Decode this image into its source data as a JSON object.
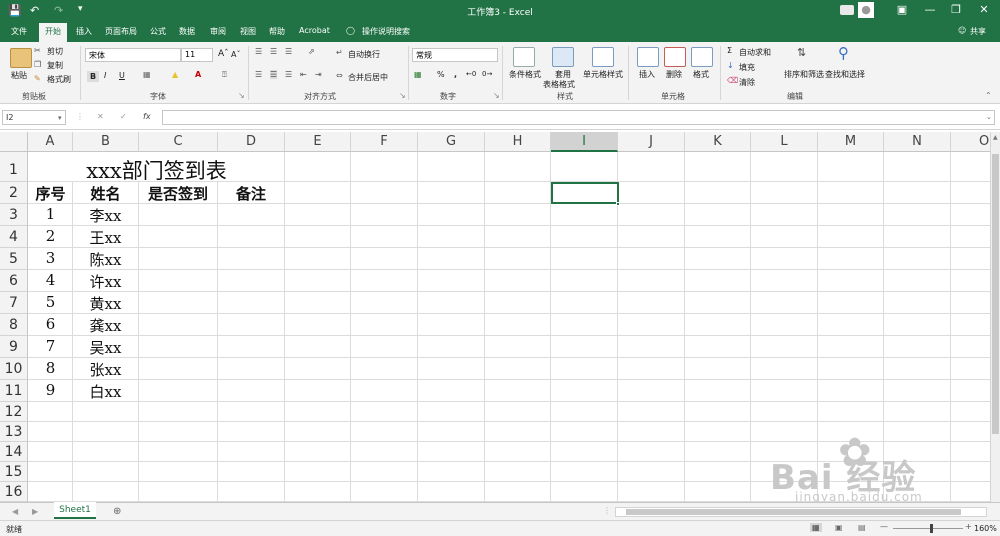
{
  "titlebar": {
    "title": "工作簿3 - Excel"
  },
  "tabs": [
    {
      "label": "文件"
    },
    {
      "label": "开始"
    },
    {
      "label": "插入"
    },
    {
      "label": "页面布局"
    },
    {
      "label": "公式"
    },
    {
      "label": "数据"
    },
    {
      "label": "审阅"
    },
    {
      "label": "视图"
    },
    {
      "label": "帮助"
    },
    {
      "label": "Acrobat"
    },
    {
      "label": "操作说明搜索"
    }
  ],
  "share_label": "共享",
  "ribbon": {
    "paste": "粘贴",
    "cut": "剪切",
    "copy": "复制",
    "format_painter": "格式刷",
    "font_name": "宋体",
    "font_size": "11",
    "wrap_text": "自动换行",
    "merge_center": "合并后居中",
    "number_format": "常规",
    "cond_format": "条件格式",
    "table_format_1": "套用",
    "table_format_2": "表格格式",
    "cell_style": "单元格样式",
    "insert": "插入",
    "delete": "删除",
    "format": "格式",
    "autosum": "自动求和",
    "fill": "填充",
    "clear": "清除",
    "sort_filter": "排序和筛选",
    "find_select": "查找和选择",
    "groups": {
      "clipboard": "剪贴板",
      "font": "字体",
      "alignment": "对齐方式",
      "number": "数字",
      "styles": "样式",
      "cells": "单元格",
      "editing": "编辑"
    }
  },
  "formula": {
    "name_box": "I2",
    "fx": "fx"
  },
  "columns": [
    "A",
    "B",
    "C",
    "D",
    "E",
    "F",
    "G",
    "H",
    "I",
    "J",
    "K",
    "L",
    "M",
    "N",
    "O"
  ],
  "rows": [
    "1",
    "2",
    "3",
    "4",
    "5",
    "6",
    "7",
    "8",
    "9",
    "10",
    "11",
    "12",
    "13",
    "14",
    "15",
    "16"
  ],
  "sheet": {
    "title": "xxx部门签到表",
    "headers": [
      "序号",
      "姓名",
      "是否签到",
      "备注"
    ],
    "records": [
      {
        "no": "1",
        "name": "李xx"
      },
      {
        "no": "2",
        "name": "王xx"
      },
      {
        "no": "3",
        "name": "陈xx"
      },
      {
        "no": "4",
        "name": "许xx"
      },
      {
        "no": "5",
        "name": "黄xx"
      },
      {
        "no": "6",
        "name": "龚xx"
      },
      {
        "no": "7",
        "name": "吴xx"
      },
      {
        "no": "8",
        "name": "张xx"
      },
      {
        "no": "9",
        "name": "白xx"
      }
    ]
  },
  "sheet_tab": "Sheet1",
  "status": {
    "ready": "就绪",
    "zoom": "160%"
  },
  "watermark": {
    "brand": "Bai  经验",
    "url": "jingyan.baidu.com"
  },
  "colors": {
    "accent": "#217346",
    "ribbon_bg": "#f3f3f3"
  }
}
